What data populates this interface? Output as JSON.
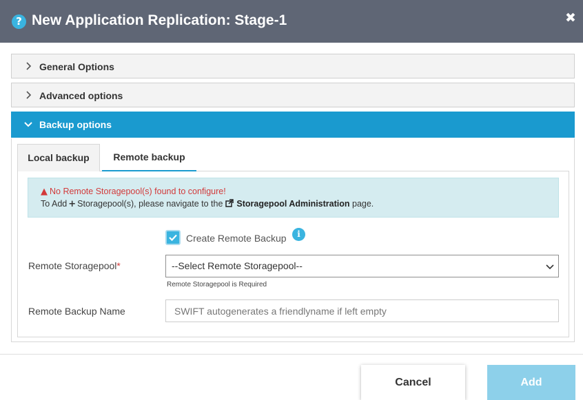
{
  "dialog": {
    "title": "New Application Replication: Stage-1",
    "help_icon": "question-circle-icon",
    "close_glyph": "✖"
  },
  "panels": [
    {
      "label": "General Options",
      "expanded": false
    },
    {
      "label": "Advanced options",
      "expanded": false
    },
    {
      "label": "Backup options",
      "expanded": true
    }
  ],
  "tabs": [
    {
      "label": "Local backup",
      "active": false
    },
    {
      "label": "Remote backup",
      "active": true
    }
  ],
  "alert": {
    "warning": "No Remote Storagepool(s) found to configure!",
    "prefix": "To Add",
    "middle": "Storagepool(s), please navigate to the",
    "link": "Storagepool Administration",
    "suffix": "page."
  },
  "form": {
    "create_remote_backup": {
      "label": "Create Remote Backup",
      "checked": true
    },
    "remote_storagepool": {
      "label": "Remote Storagepool",
      "required_mark": "*",
      "selected": "--Select Remote Storagepool--",
      "help": "Remote Storagepool is Required"
    },
    "remote_backup_name": {
      "label": "Remote Backup Name",
      "value": "",
      "placeholder": "SWIFT autogenerates a friendlyname if left empty"
    }
  },
  "footer": {
    "cancel_label": "Cancel",
    "add_label": "Add"
  },
  "colors": {
    "header_bg": "#5f6675",
    "accent": "#1a9acf",
    "alert_bg": "#d5ecf0",
    "warning_text": "#d23a3a",
    "add_button_disabled": "#8dd0ea"
  }
}
